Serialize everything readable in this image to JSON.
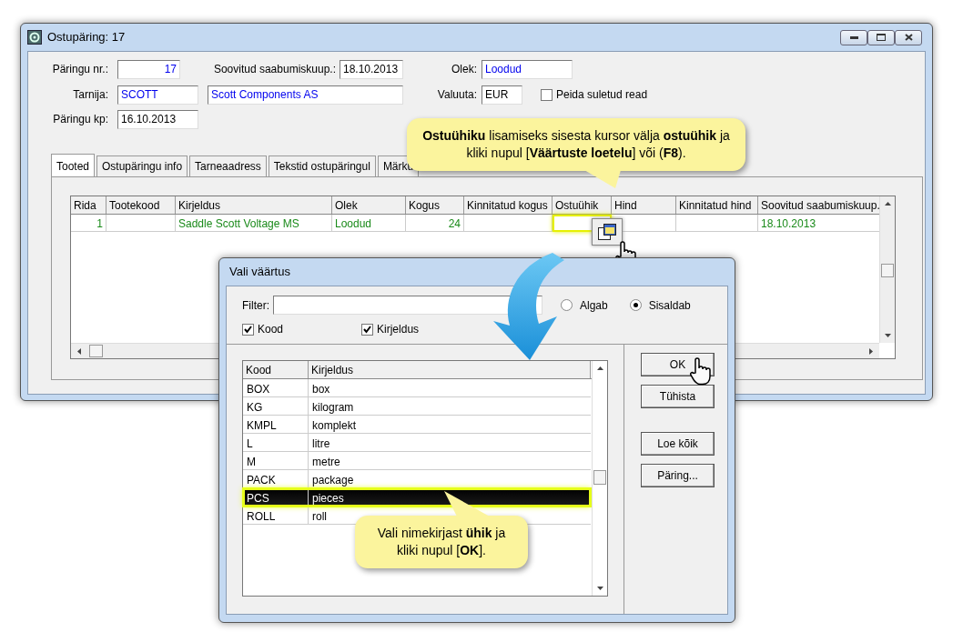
{
  "window": {
    "title": "Ostupäring: 17"
  },
  "form": {
    "request_no": {
      "label": "Päringu nr.:",
      "value": "17"
    },
    "desired_date": {
      "label": "Soovitud saabumiskuup.:",
      "value": "18.10.2013"
    },
    "status": {
      "label": "Olek:",
      "value": "Loodud"
    },
    "supplier": {
      "label": "Tarnija:",
      "code": "SCOTT",
      "name": "Scott Components AS"
    },
    "currency": {
      "label": "Valuuta:",
      "value": "EUR"
    },
    "hide_closed": {
      "label": "Peida suletud read",
      "checked": false
    },
    "request_date": {
      "label": "Päringu kp:",
      "value": "16.10.2013"
    }
  },
  "tabs": [
    {
      "label": "Tooted",
      "selected": true
    },
    {
      "label": "Ostupäringu info",
      "selected": false
    },
    {
      "label": "Tarneaadress",
      "selected": false
    },
    {
      "label": "Tekstid ostupäringul",
      "selected": false
    },
    {
      "label": "Märku",
      "selected": false
    }
  ],
  "table": {
    "columns": [
      "Rida",
      "Tootekood",
      "Kirjeldus",
      "Olek",
      "Kogus",
      "Kinnitatud kogus",
      "Ostuühik",
      "Hind",
      "Kinnitatud hind",
      "Soovitud saabumiskuup."
    ],
    "rows": [
      {
        "cells": [
          {
            "text": "1",
            "focused": false
          },
          {
            "text": "",
            "focused": false
          },
          {
            "text": "Saddle Scott Voltage MS",
            "focused": false
          },
          {
            "text": "Loodud",
            "focused": false
          },
          {
            "text": "24",
            "focused": false
          },
          {
            "text": "",
            "focused": false
          },
          {
            "text": "",
            "focused": true
          },
          {
            "text": "",
            "focused": false
          },
          {
            "text": "",
            "focused": false
          },
          {
            "text": "18.10.2013",
            "focused": false
          }
        ]
      }
    ]
  },
  "callout_top": "**Ostuühiku** lisamiseks sisesta kursor välja **ostuühik** ja kliki nupul [**Väärtuste loetelu**] või (**F8**).",
  "dialog": {
    "title": "Vali väärtus",
    "filter": {
      "label": "Filter:"
    },
    "match_modes": [
      {
        "label": "Algab",
        "selected": false
      },
      {
        "label": "Sisaldab",
        "selected": true
      }
    ],
    "search_in": [
      {
        "label": "Kood",
        "checked": true
      },
      {
        "label": "Kirjeldus",
        "checked": true
      }
    ],
    "list": {
      "columns": [
        "Kood",
        "Kirjeldus"
      ],
      "rows": [
        {
          "code": "BOX",
          "description": "box",
          "selected": false
        },
        {
          "code": "KG",
          "description": "kilogram",
          "selected": false
        },
        {
          "code": "KMPL",
          "description": "komplekt",
          "selected": false
        },
        {
          "code": "L",
          "description": "litre",
          "selected": false
        },
        {
          "code": "M",
          "description": "metre",
          "selected": false
        },
        {
          "code": "PACK",
          "description": "package",
          "selected": false
        },
        {
          "code": "PCS",
          "description": "pieces",
          "selected": true
        },
        {
          "code": "ROLL",
          "description": "roll",
          "selected": false
        }
      ]
    },
    "buttons": [
      "OK",
      "Tühista",
      "Loe kõik",
      "Päring..."
    ]
  },
  "callout_bottom": "Vali nimekirjast **ühik** ja kliki nupul [**OK**]."
}
